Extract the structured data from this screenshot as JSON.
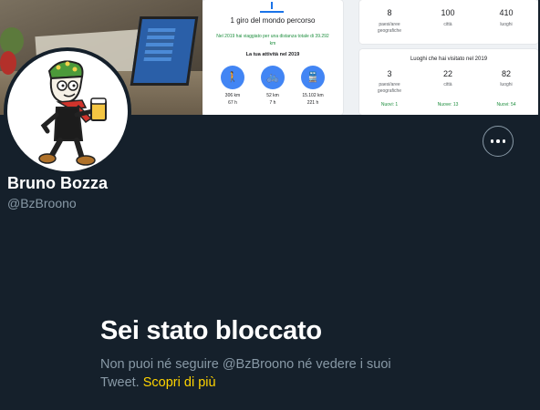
{
  "banner": {
    "activity_card": {
      "title": "1 giro del mondo percorso",
      "subtitle": "Nel 2019 hai viaggiato per una distanza totale di 39.292 km",
      "activity_header": "La tua attività nel 2019",
      "activities": [
        {
          "icon": "walking-icon",
          "distance": "306 km",
          "time": "67 h"
        },
        {
          "icon": "bicycle-icon",
          "distance": "52 km",
          "time": "7 h"
        },
        {
          "icon": "train-icon",
          "distance": "15.102 km",
          "time": "221 h"
        }
      ]
    },
    "totals_card": {
      "stats": [
        {
          "value": "8",
          "label": "paesi/aree geografiche"
        },
        {
          "value": "100",
          "label": "città"
        },
        {
          "value": "410",
          "label": "luoghi"
        }
      ]
    },
    "places_2019_card": {
      "title": "Luoghi che hai visitato nel 2019",
      "stats": [
        {
          "value": "3",
          "label": "paesi/aree geografiche",
          "new": "Nuovi: 1"
        },
        {
          "value": "22",
          "label": "città",
          "new": "Nuove: 13"
        },
        {
          "value": "82",
          "label": "luoghi",
          "new": "Nuovi: 54"
        }
      ]
    }
  },
  "profile": {
    "name": "Bruno Bozza",
    "handle": "@BzBroono"
  },
  "blocked": {
    "title": "Sei stato bloccato",
    "message": "Non puoi né seguire @BzBroono né vedere i suoi Tweet.",
    "learn_more": "Scopri di più"
  },
  "colors": {
    "background": "#15202b",
    "secondary_text": "#8899a6",
    "link": "#ffd400"
  }
}
